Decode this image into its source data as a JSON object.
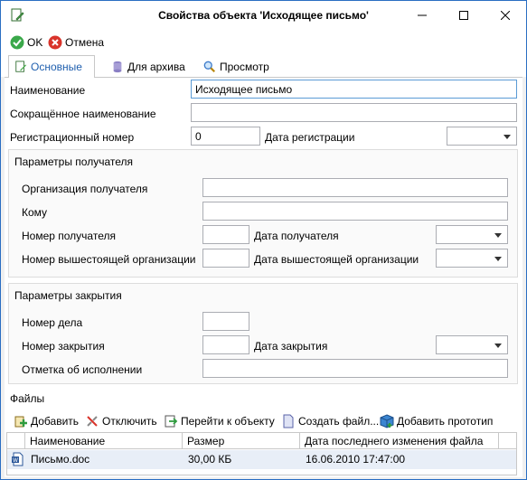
{
  "window": {
    "title": "Свойства объекта 'Исходящее письмо'"
  },
  "toolbar": {
    "ok_label": "OK",
    "cancel_label": "Отмена"
  },
  "tabs": [
    {
      "label": "Основные"
    },
    {
      "label": "Для архива"
    },
    {
      "label": "Просмотр"
    }
  ],
  "form": {
    "name_label": "Наименование",
    "name_value": "Исходящее письмо",
    "short_name_label": "Сокращённое наименование",
    "short_name_value": "",
    "reg_number_label": "Регистрационный номер",
    "reg_number_value": "0",
    "reg_date_label": "Дата регистрации",
    "reg_date_value": ""
  },
  "recipient": {
    "title": "Параметры получателя",
    "org_label": "Организация получателя",
    "org_value": "",
    "to_label": "Кому",
    "to_value": "",
    "number_label": "Номер получателя",
    "number_value": "",
    "date_label": "Дата получателя",
    "date_value": "",
    "parent_number_label": "Номер вышестоящей организации",
    "parent_number_value": "",
    "parent_date_label": "Дата вышестоящей организации",
    "parent_date_value": ""
  },
  "closing": {
    "title": "Параметры закрытия",
    "case_number_label": "Номер дела",
    "case_number_value": "",
    "closing_number_label": "Номер закрытия",
    "closing_number_value": "",
    "closing_date_label": "Дата закрытия",
    "closing_date_value": "",
    "execution_label": "Отметка об исполнении",
    "execution_value": ""
  },
  "files": {
    "title": "Файлы",
    "toolbar": {
      "add": "Добавить",
      "detach": "Отключить",
      "goto": "Перейти к объекту",
      "create": "Создать файл...",
      "add_prototype": "Добавить прототип"
    },
    "columns": [
      "Наименование",
      "Размер",
      "Дата последнего изменения файла"
    ],
    "rows": [
      {
        "name": "Письмо.doc",
        "size": "30,00 КБ",
        "modified": "16.06.2010 17:47:00"
      }
    ]
  },
  "colors": {
    "accent": "#1f5fae",
    "ok_green": "#3aa84a",
    "cancel_red": "#d9342b"
  }
}
